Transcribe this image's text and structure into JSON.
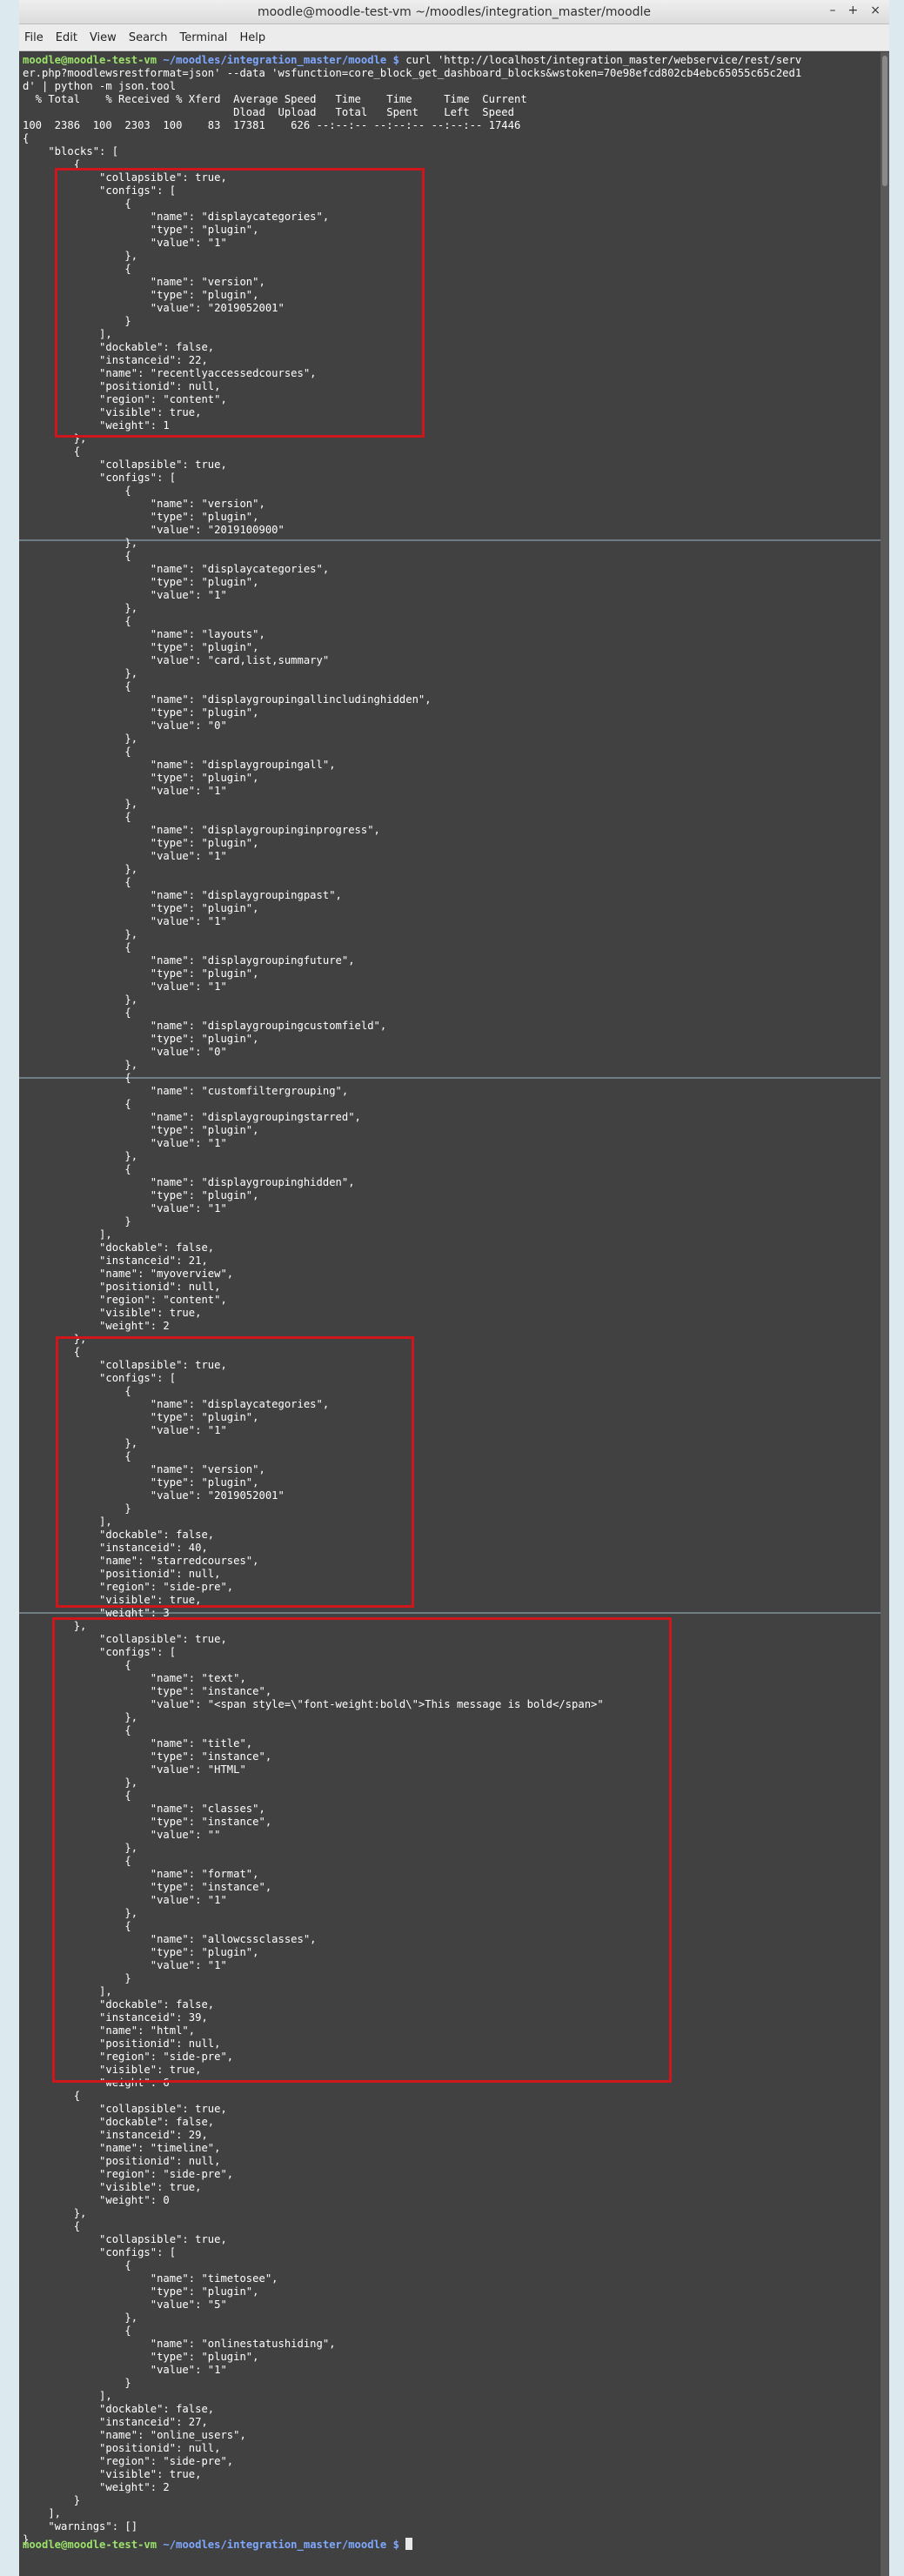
{
  "window": {
    "title": "moodle@moodle-test-vm ~/moodles/integration_master/moodle",
    "controls": [
      "–",
      "+",
      "×"
    ]
  },
  "menu": [
    "File",
    "Edit",
    "View",
    "Search",
    "Terminal",
    "Help"
  ],
  "prompt": {
    "user": "moodle@moodle-test-vm",
    "path": " ~/moodles/integration_master/moodle $ "
  },
  "command_lines": [
    "curl 'http://localhost/integration_master/webservice/rest/serv",
    "er.php?moodlewsrestformat=json' --data 'wsfunction=core_block_get_dashboard_blocks&wstoken=70e98efcd802cb4ebc65055c65c2ed1",
    "d' | python -m json.tool"
  ],
  "curl_progress": [
    "  % Total    % Received % Xferd  Average Speed   Time    Time     Time  Current",
    "                                 Dload  Upload   Total   Spent    Left  Speed",
    "100  2386  100  2303  100    83  17381    626 --:--:-- --:--:-- --:--:-- 17446"
  ],
  "output_lines": [
    "{",
    "    \"blocks\": [",
    "        {",
    "            \"collapsible\": true,",
    "            \"configs\": [",
    "                {",
    "                    \"name\": \"displaycategories\",",
    "                    \"type\": \"plugin\",",
    "                    \"value\": \"1\"",
    "                },",
    "                {",
    "                    \"name\": \"version\",",
    "                    \"type\": \"plugin\",",
    "                    \"value\": \"2019052001\"",
    "                }",
    "            ],",
    "            \"dockable\": false,",
    "            \"instanceid\": 22,",
    "            \"name\": \"recentlyaccessedcourses\",",
    "            \"positionid\": null,",
    "            \"region\": \"content\",",
    "            \"visible\": true,",
    "            \"weight\": 1",
    "        },",
    "        {",
    "            \"collapsible\": true,",
    "            \"configs\": [",
    "                {",
    "                    \"name\": \"version\",",
    "                    \"type\": \"plugin\",",
    "                    \"value\": \"2019100900\"",
    "                },",
    "                {",
    "                    \"name\": \"displaycategories\",",
    "                    \"type\": \"plugin\",",
    "                    \"value\": \"1\"",
    "                },",
    "                {",
    "                    \"name\": \"layouts\",",
    "                    \"type\": \"plugin\",",
    "                    \"value\": \"card,list,summary\"",
    "                },",
    "                {",
    "                    \"name\": \"displaygroupingallincludinghidden\",",
    "                    \"type\": \"plugin\",",
    "                    \"value\": \"0\"",
    "                },",
    "                {",
    "                    \"name\": \"displaygroupingall\",",
    "                    \"type\": \"plugin\",",
    "                    \"value\": \"1\"",
    "                },",
    "                {",
    "                    \"name\": \"displaygroupinginprogress\",",
    "                    \"type\": \"plugin\",",
    "                    \"value\": \"1\"",
    "                },",
    "                {",
    "                    \"name\": \"displaygroupingpast\",",
    "                    \"type\": \"plugin\",",
    "                    \"value\": \"1\"",
    "                },",
    "                {",
    "                    \"name\": \"displaygroupingfuture\",",
    "                    \"type\": \"plugin\",",
    "                    \"value\": \"1\"",
    "                },",
    "                {",
    "                    \"name\": \"displaygroupingcustomfield\",",
    "                    \"type\": \"plugin\",",
    "                    \"value\": \"0\"",
    "                },",
    "                {",
    "                    \"name\": \"customfiltergrouping\",",
    "                {",
    "                    \"name\": \"displaygroupingstarred\",",
    "                    \"type\": \"plugin\",",
    "                    \"value\": \"1\"",
    "                },",
    "                {",
    "                    \"name\": \"displaygroupinghidden\",",
    "                    \"type\": \"plugin\",",
    "                    \"value\": \"1\"",
    "                }",
    "            ],",
    "            \"dockable\": false,",
    "            \"instanceid\": 21,",
    "            \"name\": \"myoverview\",",
    "            \"positionid\": null,",
    "            \"region\": \"content\",",
    "            \"visible\": true,",
    "            \"weight\": 2",
    "        },",
    "        {",
    "            \"collapsible\": true,",
    "            \"configs\": [",
    "                {",
    "                    \"name\": \"displaycategories\",",
    "                    \"type\": \"plugin\",",
    "                    \"value\": \"1\"",
    "                },",
    "                {",
    "                    \"name\": \"version\",",
    "                    \"type\": \"plugin\",",
    "                    \"value\": \"2019052001\"",
    "                }",
    "            ],",
    "            \"dockable\": false,",
    "            \"instanceid\": 40,",
    "            \"name\": \"starredcourses\",",
    "            \"positionid\": null,",
    "            \"region\": \"side-pre\",",
    "            \"visible\": true,",
    "            \"weight\": 3",
    "        },",
    "            \"collapsible\": true,",
    "            \"configs\": [",
    "                {",
    "                    \"name\": \"text\",",
    "                    \"type\": \"instance\",",
    "                    \"value\": \"<span style=\\\"font-weight:bold\\\">This message is bold</span>\"",
    "                },",
    "                {",
    "                    \"name\": \"title\",",
    "                    \"type\": \"instance\",",
    "                    \"value\": \"HTML\"",
    "                },",
    "                {",
    "                    \"name\": \"classes\",",
    "                    \"type\": \"instance\",",
    "                    \"value\": \"\"",
    "                },",
    "                {",
    "                    \"name\": \"format\",",
    "                    \"type\": \"instance\",",
    "                    \"value\": \"1\"",
    "                },",
    "                {",
    "                    \"name\": \"allowcssclasses\",",
    "                    \"type\": \"plugin\",",
    "                    \"value\": \"1\"",
    "                }",
    "            ],",
    "            \"dockable\": false,",
    "            \"instanceid\": 39,",
    "            \"name\": \"html\",",
    "            \"positionid\": null,",
    "            \"region\": \"side-pre\",",
    "            \"visible\": true,",
    "            \"weight\": 6",
    "        {",
    "            \"collapsible\": true,",
    "            \"dockable\": false,",
    "            \"instanceid\": 29,",
    "            \"name\": \"timeline\",",
    "            \"positionid\": null,",
    "            \"region\": \"side-pre\",",
    "            \"visible\": true,",
    "            \"weight\": 0",
    "        },",
    "        {",
    "            \"collapsible\": true,",
    "            \"configs\": [",
    "                {",
    "                    \"name\": \"timetosee\",",
    "                    \"type\": \"plugin\",",
    "                    \"value\": \"5\"",
    "                },",
    "                {",
    "                    \"name\": \"onlinestatushiding\",",
    "                    \"type\": \"plugin\",",
    "                    \"value\": \"1\"",
    "                }",
    "            ],",
    "            \"dockable\": false,",
    "            \"instanceid\": 27,",
    "            \"name\": \"online_users\",",
    "            \"positionid\": null,",
    "            \"region\": \"side-pre\",",
    "            \"visible\": true,",
    "            \"weight\": 2",
    "        }",
    "    ],",
    "    \"warnings\": []",
    "}"
  ],
  "colors": {
    "terminal_bg": "#414141",
    "highlight": "#d0161d",
    "prompt_user": "#9be36b",
    "prompt_path": "#7fa8ff"
  }
}
